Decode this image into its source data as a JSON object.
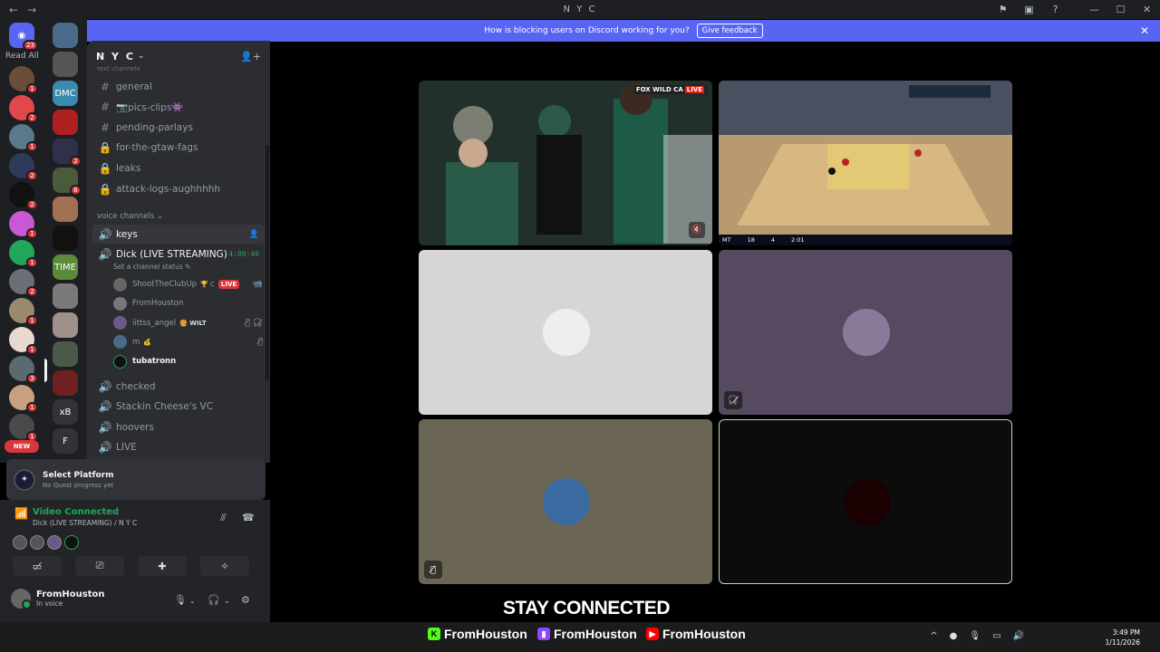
{
  "window": {
    "title": "N Y C"
  },
  "banner": {
    "text": "How is blocking users on Discord working for you?",
    "button": "Give feedback"
  },
  "servers": {
    "read_all": "Read All",
    "top_badge": "23",
    "new_label": "NEW",
    "items": [
      {
        "label": "",
        "badge": "1",
        "color": "#6b4d3a"
      },
      {
        "label": "",
        "badge": "2",
        "color": "#e0484b"
      },
      {
        "label": "",
        "badge": "1",
        "color": "#5a7a8c"
      },
      {
        "label": "",
        "badge": "2",
        "color": "#2d3a5a"
      },
      {
        "label": "",
        "badge": "2",
        "color": "#111111"
      },
      {
        "label": "",
        "badge": "1",
        "color": "#c858d4"
      },
      {
        "label": "",
        "badge": "1",
        "color": "#23a55a"
      },
      {
        "label": "",
        "badge": "2",
        "color": "#6a6f78"
      },
      {
        "label": "",
        "badge": "1",
        "color": "#9a8a70"
      },
      {
        "label": "",
        "badge": "1",
        "color": "#e8d8d0"
      },
      {
        "label": "",
        "badge": "3",
        "color": "#5a6a70"
      },
      {
        "label": "",
        "badge": "1",
        "color": "#c8a080"
      },
      {
        "label": "",
        "badge": "1",
        "color": "#4a4a4a"
      }
    ],
    "col2": [
      {
        "label": "",
        "badge": "",
        "color": "#4a6a8a"
      },
      {
        "label": "",
        "badge": "",
        "color": "#555555"
      },
      {
        "label": "DMC",
        "badge": "",
        "color": "#3a8ab0"
      },
      {
        "label": "",
        "badge": "",
        "color": "#b02020"
      },
      {
        "label": "",
        "badge": "2",
        "color": "#30304a"
      },
      {
        "label": "",
        "badge": "6",
        "color": "#4a5a3a"
      },
      {
        "label": "",
        "badge": "",
        "color": "#a07050"
      },
      {
        "label": "",
        "badge": "",
        "color": "#111111"
      },
      {
        "label": "TIME",
        "badge": "",
        "color": "#5a8a3a"
      },
      {
        "label": "",
        "badge": "",
        "color": "#7a7a7a"
      },
      {
        "label": "",
        "badge": "",
        "color": "#a0908a"
      },
      {
        "label": "",
        "badge": "",
        "color": "#4a5a4a"
      },
      {
        "label": "",
        "badge": "",
        "color": "#702020"
      },
      {
        "label": "xB",
        "badge": "",
        "color": "#313338"
      },
      {
        "label": "F",
        "badge": "",
        "color": "#313338"
      }
    ]
  },
  "guild": {
    "name": "N Y C",
    "chevron": "⌄"
  },
  "channels": {
    "text_category": "text channels",
    "text": [
      {
        "icon": "#",
        "name": "general"
      },
      {
        "icon": "#",
        "name": "📷pics-clips👾"
      },
      {
        "icon": "#",
        "name": "pending-parlays"
      },
      {
        "icon": "🔒",
        "name": "for-the-gtaw-fags"
      },
      {
        "icon": "🔒",
        "name": "leaks"
      },
      {
        "icon": "🔒",
        "name": "attack-logs-aughhhhh"
      }
    ],
    "voice_category": "voice channels ⌄",
    "voice": [
      {
        "icon": "🔊",
        "name": "keys",
        "active": true
      },
      {
        "icon": "🔊",
        "name": "Dick (LIVE STREAMING)",
        "timer": "4:00:40"
      }
    ],
    "status_placeholder": "Set a channel status ✎",
    "members": [
      {
        "name": "ShootTheClubUp",
        "extra": "🏆 C",
        "live": "LIVE",
        "tail": "📹",
        "color": "#666"
      },
      {
        "name": "FromHouston",
        "extra": "",
        "live": "",
        "tail": "",
        "color": "#777"
      },
      {
        "name": "iittss_angel",
        "extra": "",
        "tag": "🍔 WILT",
        "live": "",
        "tail": "🎙̸ 🎧̸",
        "color": "#6a5a8a"
      },
      {
        "name": "m",
        "extra": "💰",
        "live": "",
        "tail": "🎙̸",
        "color": "#4a6a8a"
      },
      {
        "name": "tubatronn",
        "extra": "",
        "live": "",
        "tail": "",
        "color": "#111"
      }
    ],
    "voice_after": [
      {
        "icon": "🔊",
        "name": "checked"
      },
      {
        "icon": "🔊",
        "name": "Stackin Cheese's VC"
      },
      {
        "icon": "🔊",
        "name": "hoovers"
      },
      {
        "icon": "🔊",
        "name": "LIVE"
      }
    ]
  },
  "quest": {
    "title": "Select Platform",
    "subtitle": "No Quest progress yet"
  },
  "voice_panel": {
    "status": "Video Connected",
    "channel": "Dick (LIVE STREAMING) / N Y C"
  },
  "user": {
    "name": "FromHouston",
    "status": "In voice"
  },
  "tiles": [
    {
      "kind": "stream",
      "bg": "#1f3a30",
      "badge": "FOX WILD CA",
      "live": "LIVE"
    },
    {
      "kind": "stream",
      "bg": "#8a7a60",
      "score": [
        "MT",
        "18",
        "4",
        "2:01"
      ]
    },
    {
      "kind": "avatar",
      "bg": "#d6d6d6",
      "avatar_color": "#eeeeee"
    },
    {
      "kind": "avatar",
      "bg": "#554a5f",
      "avatar_color": "#8a7a9a"
    },
    {
      "kind": "avatar",
      "bg": "#6b6654",
      "avatar_color": "#3a6aa0"
    },
    {
      "kind": "avatar",
      "bg": "#0c0c0c",
      "avatar_color": "#1a0000"
    }
  ],
  "overlay": {
    "headline": "STAY CONNECTED",
    "handles": [
      {
        "platform": "kick",
        "name": "FromHouston",
        "color": "#53fc18"
      },
      {
        "platform": "twitch",
        "name": "FromHouston",
        "color": "#9146ff"
      },
      {
        "platform": "youtube",
        "name": "FromHouston",
        "color": "#ff0000"
      }
    ]
  },
  "clock": {
    "time": "3:49 PM",
    "date": "1/11/2026"
  }
}
